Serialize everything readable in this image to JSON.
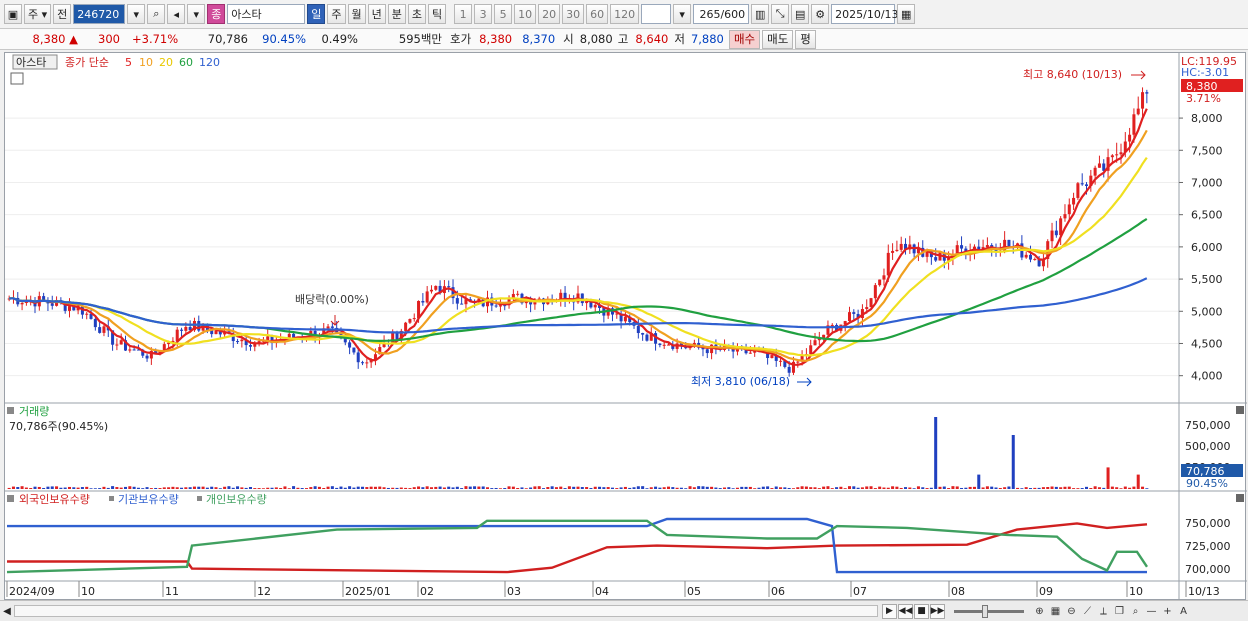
{
  "toolbar": {
    "market": "주",
    "period_prev": "전",
    "code": "246720",
    "name_prefix": "종",
    "name": "아스타",
    "periods": [
      "일",
      "주",
      "월",
      "년",
      "분",
      "초",
      "틱"
    ],
    "intervals": [
      "1",
      "3",
      "5",
      "10",
      "20",
      "30",
      "60",
      "120"
    ],
    "count": "265/600",
    "date": "2025/10/13"
  },
  "quote": {
    "price": "8,380",
    "price_arrow": "▲",
    "change": "300",
    "change_pct": "+3.71%",
    "volume": "70,786",
    "volume_ratio": "90.45%",
    "turnover": "0.49%",
    "amount": "595백만",
    "hoga_label": "호가",
    "ask": "8,380",
    "bid": "8,370",
    "open_label": "시",
    "open": "8,080",
    "high_label": "고",
    "high": "8,640",
    "low_label": "저",
    "low": "7,880",
    "buy_btn": "매수",
    "sell_btn": "매도",
    "avg_btn": "평"
  },
  "price_panel": {
    "stock_name": "아스타",
    "legend_prefix": "종가 단순",
    "ma_periods": [
      "5",
      "10",
      "20",
      "60",
      "120"
    ],
    "ma_colors": [
      "#e02020",
      "#f0a020",
      "#f0e020",
      "#20a040",
      "#3060d0"
    ],
    "lc_label": "LC:119.95",
    "hc_label": "HC:-3.01",
    "last_price_tag": "8,380",
    "last_pct_tag": "3.71%",
    "y_ticks": [
      "8,000",
      "7,500",
      "7,000",
      "6,500",
      "6,000",
      "5,500",
      "5,000",
      "4,500",
      "4,000"
    ],
    "high_annotation": "최고 8,640 (10/13)",
    "low_annotation": "최저 3,810 (06/18)",
    "dividend_annotation": "배당락(0.00%)"
  },
  "volume_panel": {
    "title": "거래량",
    "current": "70,786주(90.45%)",
    "y_ticks": [
      "750,000",
      "500,000",
      "250,000"
    ],
    "tag_value": "70,786",
    "tag_pct": "90.45%"
  },
  "holding_panel": {
    "legend": [
      "외국인보유수량",
      "기관보유수량",
      "개인보유수량"
    ],
    "legend_colors": [
      "#d02020",
      "#3060d0",
      "#40a060"
    ],
    "y_ticks": [
      "750,000",
      "725,000",
      "700,000"
    ]
  },
  "x_axis": [
    "2024/09",
    "10",
    "11",
    "12",
    "2025/01",
    "02",
    "03",
    "04",
    "05",
    "06",
    "07",
    "08",
    "09",
    "10",
    "10/13"
  ],
  "chart_data": {
    "type": "line",
    "price_series_description": "candlestick",
    "close_approx": [
      5200,
      5150,
      5050,
      4500,
      4300,
      4800,
      4650,
      4500,
      4600,
      4700,
      4200,
      4700,
      5400,
      5100,
      5200,
      5200,
      5250,
      4950,
      4600,
      4450,
      4400,
      4350,
      4100,
      4700,
      5000,
      6100,
      5800,
      6000,
      6050,
      5800,
      6900,
      7300,
      8380
    ],
    "ylim": [
      3700,
      8700
    ],
    "volume_peak": 750000
  }
}
